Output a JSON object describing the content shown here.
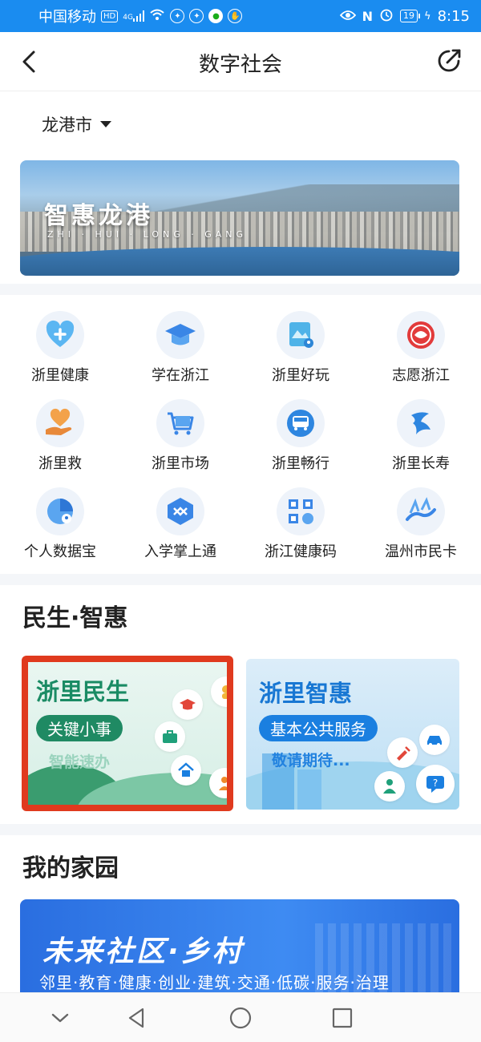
{
  "status_bar": {
    "carrier": "中国移动",
    "hd_badge": "HD",
    "network": "4G",
    "battery": "19",
    "time": "8:15"
  },
  "nav": {
    "title": "数字社会"
  },
  "location": {
    "city": "龙港市"
  },
  "banner": {
    "title": "智惠龙港",
    "subtitle": "ZHI · HUI · LONG · GANG"
  },
  "services": [
    {
      "label": "浙里健康",
      "icon": "health-heart-icon"
    },
    {
      "label": "学在浙江",
      "icon": "graduation-cap-icon"
    },
    {
      "label": "浙里好玩",
      "icon": "scenic-map-icon"
    },
    {
      "label": "志愿浙江",
      "icon": "volunteer-logo-icon"
    },
    {
      "label": "浙里救",
      "icon": "helping-hand-icon"
    },
    {
      "label": "浙里市场",
      "icon": "shopping-cart-icon"
    },
    {
      "label": "浙里畅行",
      "icon": "bus-icon"
    },
    {
      "label": "浙里长寿",
      "icon": "longevity-crane-icon"
    },
    {
      "label": "个人数据宝",
      "icon": "data-pie-icon"
    },
    {
      "label": "入学掌上通",
      "icon": "school-box-icon"
    },
    {
      "label": "浙江健康码",
      "icon": "qr-code-icon"
    },
    {
      "label": "温州市民卡",
      "icon": "citizen-card-icon"
    }
  ],
  "livelihood": {
    "title": "民生·智惠",
    "card_left": {
      "title": "浙里民生",
      "pill": "关键小事",
      "sub": "智能速办"
    },
    "card_right": {
      "title": "浙里智惠",
      "pill": "基本公共服务",
      "sub": "敬请期待..."
    }
  },
  "home": {
    "title": "我的家园",
    "banner_title": "未来社区·乡村",
    "banner_sub": "邻里·教育·健康·创业·建筑·交通·低碳·服务·治理"
  },
  "colors": {
    "status_bar": "#1a8cf0",
    "highlight_border": "#e03a1e",
    "green_accent": "#1a8b64",
    "blue_accent": "#1877d3"
  }
}
